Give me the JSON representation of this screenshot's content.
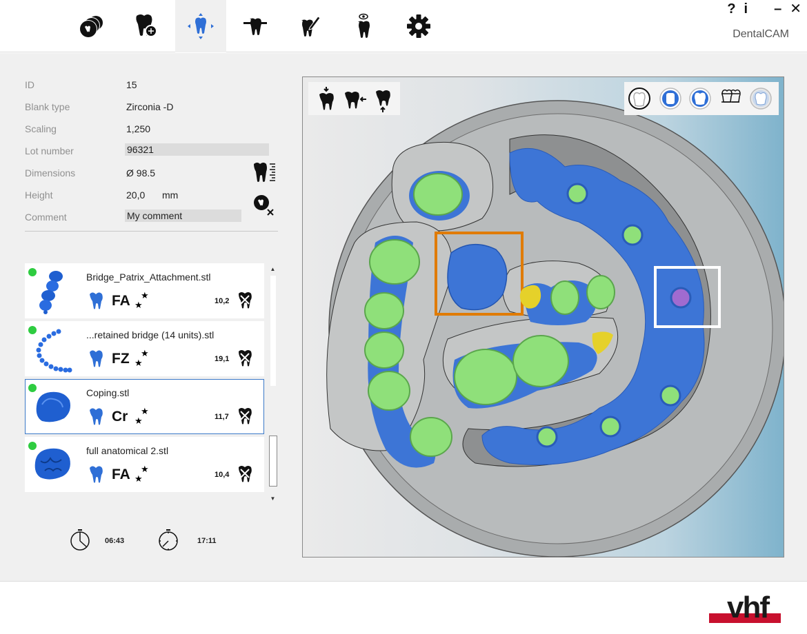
{
  "window": {
    "help_label": "?",
    "info_label": "i",
    "minimize_label": "–",
    "close_label": "✕",
    "app_title": "DentalCAM"
  },
  "nav": {
    "items": [
      {
        "name": "blank-tab",
        "icon": "blank-disc-icon"
      },
      {
        "name": "job-import-tab",
        "icon": "tooth-add-icon"
      },
      {
        "name": "positioning-tab",
        "icon": "tooth-move-icon",
        "active": true
      },
      {
        "name": "connectors-tab",
        "icon": "tooth-connector-icon"
      },
      {
        "name": "edit-tab",
        "icon": "tooth-edit-icon"
      },
      {
        "name": "preview-tab",
        "icon": "tooth-preview-icon"
      },
      {
        "name": "settings-tab",
        "icon": "gear-icon"
      }
    ]
  },
  "properties": {
    "id": {
      "label": "ID",
      "value": "15"
    },
    "blank_type": {
      "label": "Blank type",
      "value": "Zirconia -D"
    },
    "scaling": {
      "label": "Scaling",
      "value": "1,250"
    },
    "lot_number": {
      "label": "Lot number",
      "value": "96321"
    },
    "dimensions": {
      "label": "Dimensions",
      "value": "Ø 98.5"
    },
    "height": {
      "label": "Height",
      "value": "20,0",
      "unit": "mm"
    },
    "comment": {
      "label": "Comment",
      "value": "My comment"
    }
  },
  "jobs": [
    {
      "name": "Bridge_Patrix_Attachment.stl",
      "material": "FA",
      "size": "10,2",
      "selected": false
    },
    {
      "name": "...retained bridge (14 units).stl",
      "material": "FZ",
      "size": "19,1",
      "selected": false
    },
    {
      "name": "Coping.stl",
      "material": "Cr",
      "size": "11,7",
      "selected": true
    },
    {
      "name": "full anatomical 2.stl",
      "material": "FA",
      "size": "10,4",
      "selected": false
    }
  ],
  "timers": {
    "elapsed": "06:43",
    "total": "17:11"
  },
  "colors": {
    "accent_blue": "#2f6fd6",
    "restoration_blue": "#3d75d6",
    "restoration_green": "#8fe07a",
    "selection_orange": "#e07b00",
    "status_green": "#2ecc40",
    "brand_red": "#c8102e"
  },
  "brand": {
    "logo_text": "vhf"
  }
}
